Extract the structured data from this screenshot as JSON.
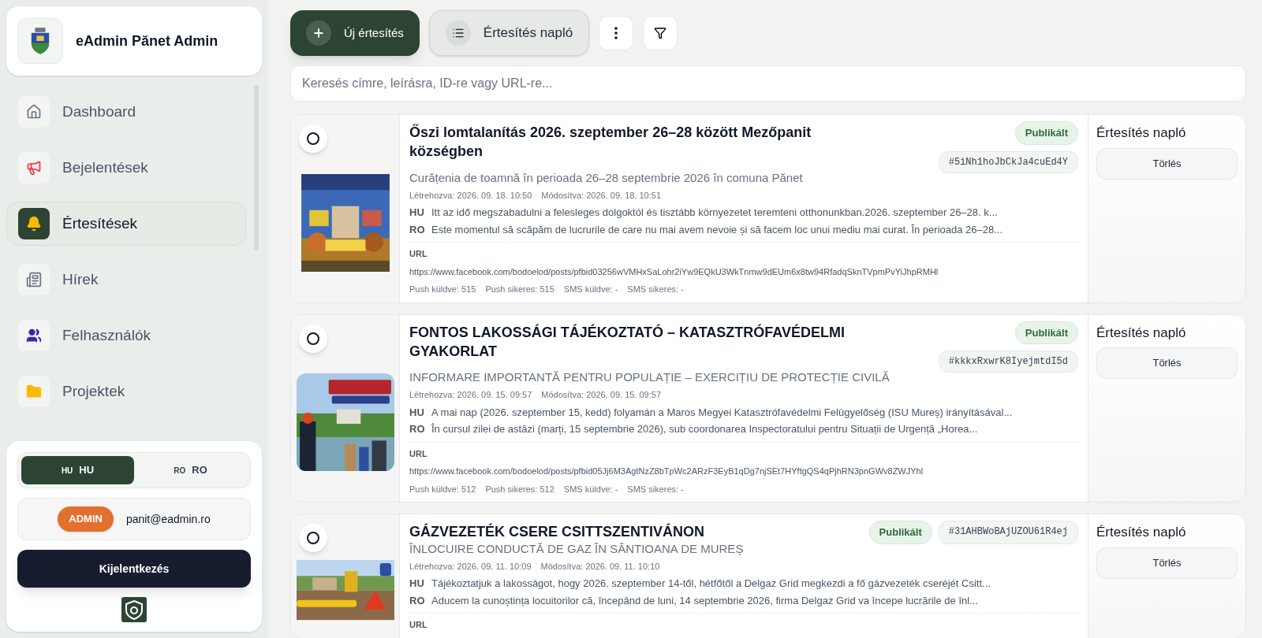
{
  "sidebar": {
    "title": "eAdmin Pănet Admin",
    "items": [
      {
        "kind": "home",
        "label": "Dashboard",
        "selected": false
      },
      {
        "kind": "megaphone",
        "label": "Bejelentések",
        "selected": false
      },
      {
        "kind": "bell",
        "label": "Értesítések",
        "selected": true
      },
      {
        "kind": "news",
        "label": "Hírek",
        "selected": false
      },
      {
        "kind": "users",
        "label": "Felhasználók",
        "selected": false
      },
      {
        "kind": "folder",
        "label": "Projektek",
        "selected": false
      }
    ],
    "languages": [
      {
        "code": "HU",
        "label": "HU",
        "selected": true
      },
      {
        "code": "RO",
        "label": "RO",
        "selected": false
      }
    ],
    "role": "ADMIN",
    "email": "panit@eadmin.ro",
    "logout": "Kijelentkezés"
  },
  "toolbar": {
    "new_button": "Új értesítés",
    "log_button": "Értesítés napló"
  },
  "search": {
    "placeholder": "Keresés címre, leírásra, ID-re vagy URL-re..."
  },
  "notifications": [
    {
      "selected": false,
      "title": "Őszi lomtalanítás 2026. szeptember 26–28 között Mezőpanit községben",
      "status": "Publikált",
      "id": "#5iNh1hoJbCkJa4cuEd4Y",
      "subtitle": "Curățenia de toamnă în perioada 26–28 septembrie 2026 în comuna Pănet",
      "created": "Létrehozva: 2026. 09. 18. 10:50",
      "modified": "Módosítva: 2026. 09. 18. 10:51",
      "texts": [
        {
          "lang": "HU",
          "text": "Itt az idő megszabadulni a felesleges dolgoktól és tisztább környezetet teremteni otthonunkban.2026. szeptember 26–28. k..."
        },
        {
          "lang": "RO",
          "text": "Este momentul să scăpăm de lucrurile de care nu mai avem nevoie și să facem loc unui mediu mai curat. În perioada 26–28..."
        }
      ],
      "url_label": "URL",
      "url": "https://www.facebook.com/bodoelod/posts/pfbid03256wVMHxSaLohr2iYw9EQkU3WkTnmw9dEUm6x8tw94RfadqSknTVpmPvYiJhpRMHl",
      "stats": [
        "Push küldve: 515",
        "Push sikeres: 515",
        "SMS küldve: -",
        "SMS sikeres: -"
      ],
      "panel_title": "Értesítés napló",
      "delete_button": "Törlés"
    },
    {
      "selected": false,
      "title": "FONTOS LAKOSSÁGI TÁJÉKOZTATÓ – KATASZTRÓFAVÉDELMI GYAKORLAT",
      "status": "Publikált",
      "id": "#kkkxRxwrK8IyejmtdI5d",
      "subtitle": "INFORMARE IMPORTANTĂ PENTRU POPULAȚIE – EXERCIȚIU DE PROTECȚIE CIVILĂ",
      "created": "Létrehozva: 2026. 09. 15. 09:57",
      "modified": "Módosítva: 2026. 09. 15. 09:57",
      "texts": [
        {
          "lang": "HU",
          "text": "A mai nap (2026. szeptember 15, kedd) folyamán a Maros Megyei Katasztrófavédelmi Felügyelőség (ISU Mureș) irányításával..."
        },
        {
          "lang": "RO",
          "text": "În cursul zilei de astăzi (marți, 15 septembrie 2026), sub coordonarea Inspectoratului pentru Situații de Urgență „Horea..."
        }
      ],
      "url_label": "URL",
      "url": "https://www.facebook.com/bodoelod/posts/pfbid05Jj6M3AgtNzZ8bTpWc2ARzF3EyB1qDg7njSEt7HYftgQS4qPjhRN3pnGWv8ZWJYhl",
      "stats": [
        "Push küldve: 512",
        "Push sikeres: 512",
        "SMS küldve: -",
        "SMS sikeres: -"
      ],
      "panel_title": "Értesítés napló",
      "delete_button": "Törlés"
    },
    {
      "selected": false,
      "title": "GÁZVEZETÉK CSERE CSITTSZENTIVÁNON",
      "status": "Publikált",
      "id": "#31AHBWoBAjUZOU61R4ej",
      "subtitle": "ÎNLOCUIRE CONDUCTĂ DE GAZ ÎN SÂNTIOANA DE MUREȘ",
      "created": "Létrehozva: 2026. 09. 11. 10:09",
      "modified": "Módosítva: 2026. 09. 11. 10:10",
      "texts": [
        {
          "lang": "HU",
          "text": "Tájékoztatjuk a lakosságot, hogy 2026. szeptember 14-től, hétfőtől a Delgaz Grid megkezdi a fő gázvezeték cseréjét Csitt..."
        },
        {
          "lang": "RO",
          "text": "Aducem la cunoștința locuitorilor că, începând de luni, 14 septembrie 2026, firma Delgaz Grid va începe lucrările de înl..."
        }
      ],
      "url_label": "URL",
      "panel_title": "Értesítés napló",
      "delete_button": "Törlés"
    }
  ]
}
